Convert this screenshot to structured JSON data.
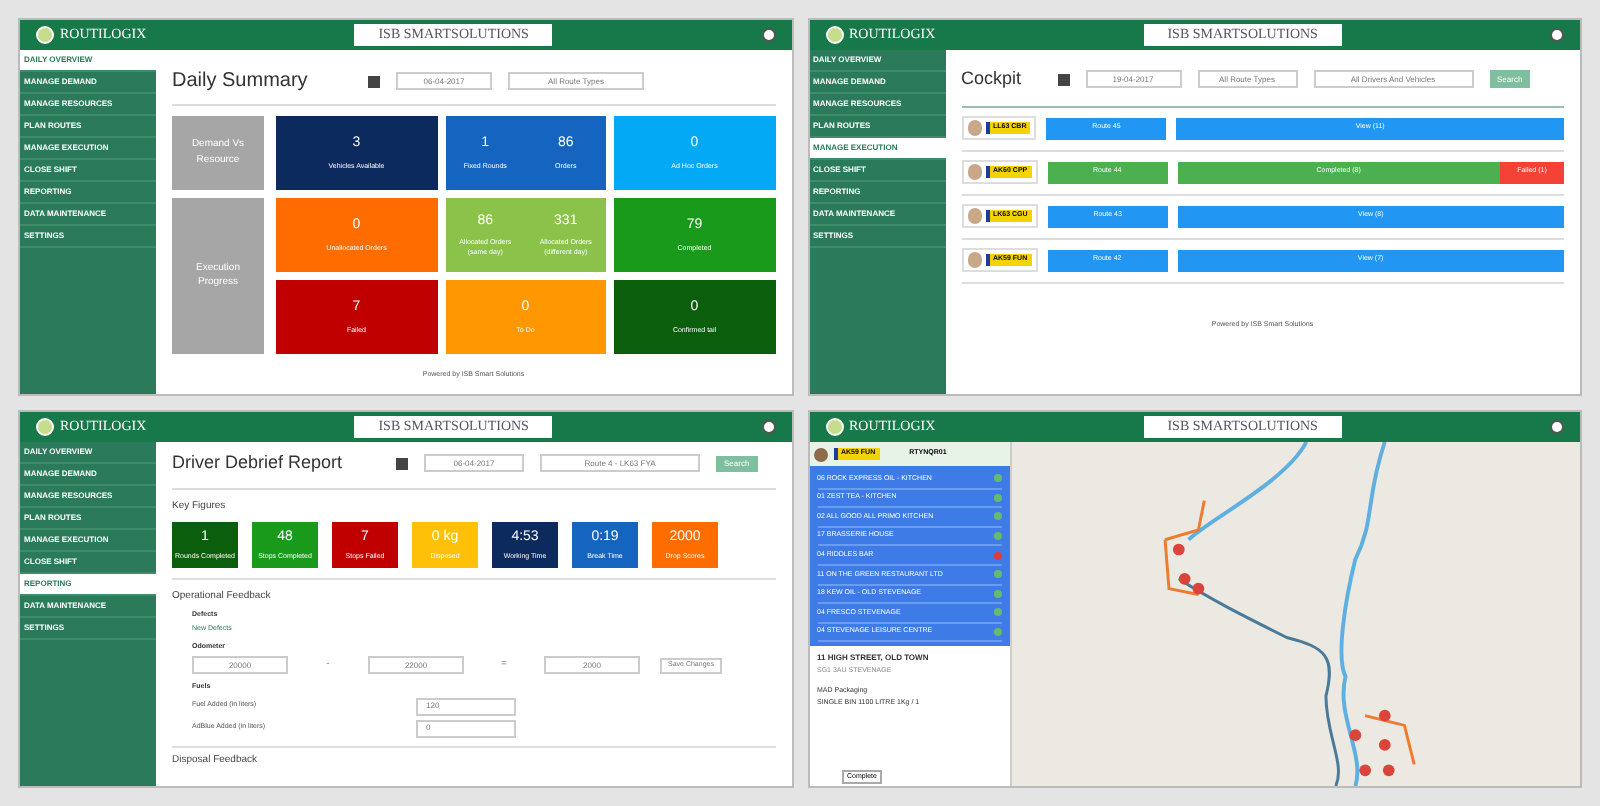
{
  "panels": [
    {
      "kind": "summary",
      "header": {
        "app": "ROUTILOGIX",
        "brand": "ISB SMARTSOLUTIONS"
      },
      "sidebar": [
        {
          "label": "DAILY OVERVIEW",
          "selected": true
        },
        {
          "label": "MANAGE DEMAND",
          "selected": false
        },
        {
          "label": "MANAGE RESOURCES",
          "selected": false
        },
        {
          "label": "PLAN ROUTES",
          "selected": false
        },
        {
          "label": "MANAGE EXECUTION",
          "selected": false
        },
        {
          "label": "CLOSE SHIFT",
          "selected": false
        },
        {
          "label": "REPORTING",
          "selected": false
        },
        {
          "label": "DATA MAINTENANCE",
          "selected": false
        },
        {
          "label": "SETTINGS",
          "selected": false
        }
      ],
      "title": "Daily Summary",
      "date": "06-04-2017",
      "select": "All Route Types",
      "groups": [
        {
          "label": "Demand Vs Resource",
          "tiles": [
            {
              "color": "#0d2a5e",
              "values": [
                {
                  "value": "3",
                  "label": "Vehicles Available"
                }
              ]
            },
            {
              "color": "#1565c0",
              "values": [
                {
                  "value": "1",
                  "label": "Fixed Rounds"
                },
                {
                  "value": "86",
                  "label": "Orders"
                }
              ]
            },
            {
              "color": "#03a9f4",
              "values": [
                {
                  "value": "0",
                  "label": "Ad Hoc Orders"
                }
              ]
            }
          ]
        },
        {
          "label": "Execution Progress",
          "tiles": [
            {
              "color": "#ff6d00",
              "values": [
                {
                  "value": "0",
                  "label": "Unallocated Orders"
                }
              ]
            },
            {
              "color": "#8bc34a",
              "values": [
                {
                  "value": "86",
                  "label": "Allocated Orders (same day)"
                },
                {
                  "value": "331",
                  "label": "Allocated Orders (different day)"
                }
              ]
            },
            {
              "color": "#1a9a1a",
              "values": [
                {
                  "value": "79",
                  "label": "Completed"
                }
              ]
            },
            {
              "color": "#c00000",
              "values": [
                {
                  "value": "7",
                  "label": "Failed"
                }
              ]
            },
            {
              "color": "#ff9800",
              "values": [
                {
                  "value": "0",
                  "label": "To Do"
                }
              ]
            },
            {
              "color": "#0b5e0b",
              "values": [
                {
                  "value": "0",
                  "label": "Confirmed tail"
                }
              ]
            }
          ]
        }
      ],
      "footer": "Powered by ISB Smart Solutions"
    },
    {
      "kind": "cockpit",
      "header": {
        "app": "ROUTILOGIX",
        "brand": "ISB SMARTSOLUTIONS"
      },
      "sidebar": [
        {
          "label": "DAILY OVERVIEW",
          "selected": false
        },
        {
          "label": "MANAGE DEMAND",
          "selected": false
        },
        {
          "label": "MANAGE RESOURCES",
          "selected": false
        },
        {
          "label": "PLAN ROUTES",
          "selected": false
        },
        {
          "label": "MANAGE EXECUTION",
          "selected": true
        },
        {
          "label": "CLOSE SHIFT",
          "selected": false
        },
        {
          "label": "REPORTING",
          "selected": false
        },
        {
          "label": "DATA MAINTENANCE",
          "selected": false
        },
        {
          "label": "SETTINGS",
          "selected": false
        }
      ],
      "title": "Cockpit",
      "date": "19-04-2017",
      "select": "All Route Types",
      "select2": "All Drivers And Vehicles",
      "button": "Search",
      "rows": [
        {
          "plate": "LL63 CBR",
          "route": "Route 45",
          "color": "#2196f3",
          "segments": [
            {
              "label": "View (11)",
              "color": "#2196f3",
              "kind": "view"
            }
          ]
        },
        {
          "plate": "AK60 CPP",
          "route": "Route 44",
          "color": "#4caf50",
          "segments": [
            {
              "label": "Completed (8)",
              "color": "#4caf50",
              "kind": "completed"
            },
            {
              "label": "Failed (1)",
              "color": "#f44336",
              "kind": "failed"
            }
          ]
        },
        {
          "plate": "LK63 CGU",
          "route": "Route 43",
          "color": "#2196f3",
          "segments": [
            {
              "label": "View (8)",
              "color": "#2196f3",
              "kind": "view"
            }
          ]
        },
        {
          "plate": "AK59 FUN",
          "route": "Route 42",
          "color": "#2196f3",
          "segments": [
            {
              "label": "View (7)",
              "color": "#2196f3",
              "kind": "view"
            }
          ]
        }
      ],
      "footer": "Powered by ISB Smart Solutions"
    },
    {
      "kind": "debrief",
      "header": {
        "app": "ROUTILOGIX",
        "brand": "ISB SMARTSOLUTIONS"
      },
      "sidebar": [
        {
          "label": "DAILY OVERVIEW",
          "selected": false
        },
        {
          "label": "MANAGE DEMAND",
          "selected": false
        },
        {
          "label": "MANAGE RESOURCES",
          "selected": false
        },
        {
          "label": "PLAN ROUTES",
          "selected": false
        },
        {
          "label": "MANAGE EXECUTION",
          "selected": false
        },
        {
          "label": "CLOSE SHIFT",
          "selected": false
        },
        {
          "label": "REPORTING",
          "selected": true
        },
        {
          "label": "DATA MAINTENANCE",
          "selected": false
        },
        {
          "label": "SETTINGS",
          "selected": false
        }
      ],
      "title": "Driver Debrief Report",
      "date": "06-04-2017",
      "select": "Route 4 - LK63 FYA",
      "button": "Search",
      "key_figures_title": "Key Figures",
      "figures": [
        {
          "value": "1",
          "label": "Rounds Completed",
          "color": "#0b5e0b"
        },
        {
          "value": "48",
          "label": "Stops Completed",
          "color": "#1a9a1a"
        },
        {
          "value": "7",
          "label": "Stops Failed",
          "color": "#c00000"
        },
        {
          "value": "0 kg",
          "label": "Disposed",
          "color": "#ffc107"
        },
        {
          "value": "4:53",
          "label": "Working Time",
          "color": "#0d2a5e"
        },
        {
          "value": "0:19",
          "label": "Break Time",
          "color": "#1565c0"
        },
        {
          "value": "2000",
          "label": "Drop Scores",
          "color": "#ff6d00"
        }
      ],
      "operational_title": "Operational Feedback",
      "defects_label": "Defects",
      "defects_link": "New Defects",
      "odometer_label": "Odometer",
      "odometer": [
        "20000",
        "22000",
        "2000"
      ],
      "minus": "-",
      "equals": "=",
      "save_button": "Save Changes",
      "fuels_label": "Fuels",
      "fuels": [
        {
          "label": "Fuel Added (in liters)",
          "value": "120"
        },
        {
          "label": "AdBlue Added (in liters)",
          "value": "0"
        }
      ],
      "disposal_title": "Disposal Feedback"
    },
    {
      "kind": "map",
      "header": {
        "app": "ROUTILOGIX",
        "brand": "ISB SMARTSOLUTIONS"
      },
      "plate": "AK59 FUN",
      "reference": "RTYNQR01",
      "stops": [
        {
          "label": "06 ROCK EXPRESS OIL - KITCHEN",
          "failed": false
        },
        {
          "label": "01 ZEST TEA - KITCHEN",
          "failed": false
        },
        {
          "label": "02 ALL GOOD ALL PRIMO KITCHEN",
          "failed": false
        },
        {
          "label": "17 BRASSERIE HOUSE",
          "failed": false
        },
        {
          "label": "04 RIDDLES BAR",
          "failed": true
        },
        {
          "label": "11 ON THE GREEN RESTAURANT LTD",
          "failed": false
        },
        {
          "label": "18 KEW OIL - OLD STEVENAGE",
          "failed": false
        },
        {
          "label": "04 FRESCO STEVENAGE",
          "failed": false
        },
        {
          "label": "04 STEVENAGE LEISURE CENTRE",
          "failed": false
        }
      ],
      "address": "11 HIGH STREET, OLD TOWN",
      "address_note": "SG1 3AU STEVENAGE",
      "item": "MAD Packaging",
      "item_note": "SINGLE BIN 1100 LITRE 1Kg / 1",
      "map_button": "Complete"
    }
  ]
}
